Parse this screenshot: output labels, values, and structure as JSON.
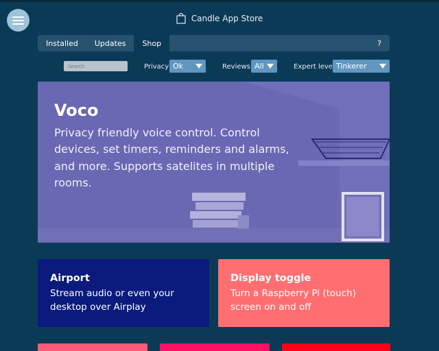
{
  "app": {
    "title": "Candle App Store",
    "menu_icon": "hamburger-icon",
    "title_icon": "shopping-bag-icon"
  },
  "tabs": [
    {
      "label": "Installed",
      "active": false
    },
    {
      "label": "Updates",
      "active": false
    },
    {
      "label": "Shop",
      "active": true
    }
  ],
  "help_label": "?",
  "filters": {
    "search_placeholder": "Search",
    "privacy": {
      "label": "Privacy",
      "value": "Ok"
    },
    "reviews": {
      "label": "Reviews",
      "value": "All"
    },
    "expert": {
      "label": "Expert level",
      "value": "Tinkerer"
    }
  },
  "featured": {
    "title": "Voco",
    "description": "Privacy friendly voice control. Control devices, set timers, reminders and alarms, and more. Supports satelites in multiple rooms.",
    "color": "#6a67b3"
  },
  "cards": [
    {
      "title": "Airport",
      "description": "Stream audio or even your desktop over Airplay",
      "color": "#0a1a7d"
    },
    {
      "title": "Display toggle",
      "description": "Turn a Raspberry Pi (touch) screen on and off",
      "color": "#ff6f71"
    }
  ],
  "more_cards": [
    {
      "color": "#ff5a78"
    },
    {
      "color": "#ff0f63"
    },
    {
      "color": "#ff0019"
    }
  ]
}
